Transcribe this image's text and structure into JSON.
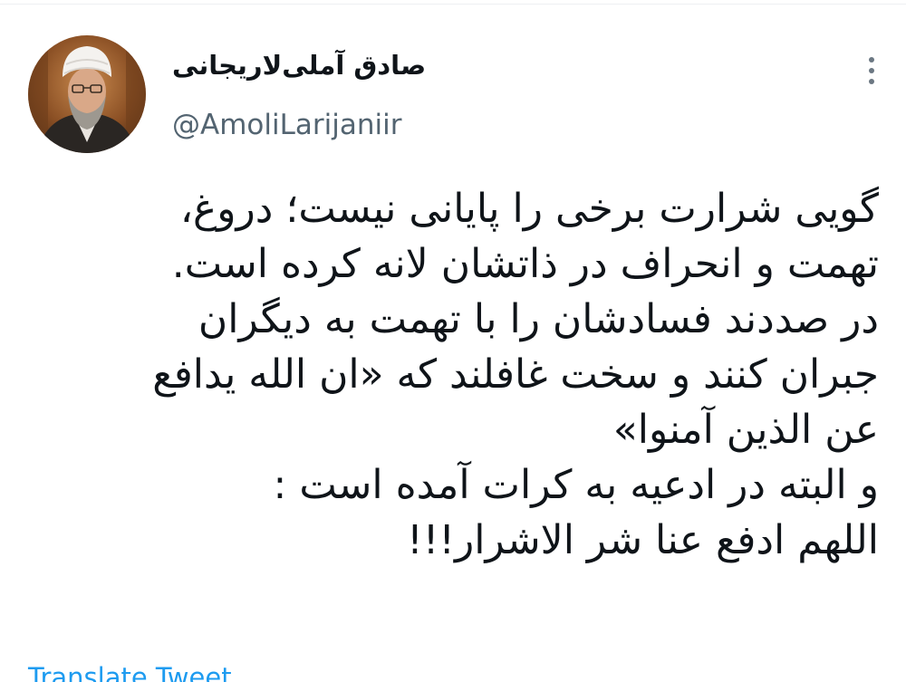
{
  "tweet": {
    "author": {
      "display_name": "صادق آملی‌لاریجانی",
      "handle": "@AmoliLarijaniir",
      "avatar_icon": "profile-photo"
    },
    "more_icon": "more-vertical-icon",
    "lines": [
      "گویی شرارت برخی را پایانی نیست؛ دروغ،",
      "تهمت و انحراف در ذاتشان لانه کرده است.",
      "در صددند فسادشان را با تهمت به دیگران",
      "جبران کنند و سخت غافلند که «ان الله یدافع",
      "عن الذین آمنوا»",
      "و البته در ادعیه به کرات آمده است :",
      "اللهم ادفع عنا شر الاشرار!!!"
    ],
    "translate_label": "Translate Tweet"
  },
  "colors": {
    "text": "#0f1419",
    "secondary": "#536471",
    "link": "#1d9bf0",
    "background": "#ffffff"
  }
}
